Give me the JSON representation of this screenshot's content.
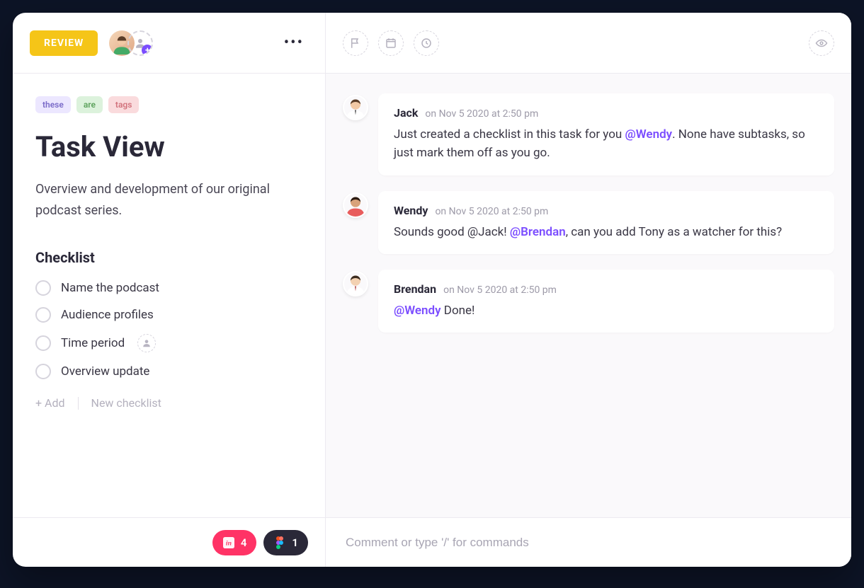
{
  "header": {
    "status_label": "REVIEW"
  },
  "tags": [
    {
      "label": "these",
      "cls": "purple"
    },
    {
      "label": "are",
      "cls": "green"
    },
    {
      "label": "tags",
      "cls": "pink"
    }
  ],
  "title": "Task View",
  "description": "Overview and development of our original podcast series.",
  "checklist": {
    "title": "Checklist",
    "items": [
      {
        "label": "Name the podcast",
        "assignable": false
      },
      {
        "label": "Audience profiles",
        "assignable": false
      },
      {
        "label": "Time period",
        "assignable": true
      },
      {
        "label": "Overview update",
        "assignable": false
      }
    ],
    "add_label": "+ Add",
    "new_label": "New checklist"
  },
  "footer_chips": {
    "invision_count": "4",
    "figma_count": "1"
  },
  "comments": [
    {
      "author": "Jack",
      "time": "on Nov 5 2020 at 2:50 pm",
      "body_parts": [
        {
          "t": "Just created a checklist in this task for you "
        },
        {
          "t": "@Wendy",
          "mention": true
        },
        {
          "t": ". None have subtasks, so just mark them off as you go."
        }
      ]
    },
    {
      "author": "Wendy",
      "time": "on Nov 5 2020 at 2:50 pm",
      "body_parts": [
        {
          "t": "Sounds good @Jack! "
        },
        {
          "t": "@Brendan",
          "mention": true
        },
        {
          "t": ", can you add Tony as a watcher for this?"
        }
      ]
    },
    {
      "author": "Brendan",
      "time": "on Nov 5 2020 at 2:50 pm",
      "body_parts": [
        {
          "t": "@Wendy",
          "mention": true
        },
        {
          "t": " Done!"
        }
      ]
    }
  ],
  "composer": {
    "placeholder": "Comment or type '/' for commands"
  },
  "avatar_colors": {
    "jack": {
      "skin": "#f2c9a5",
      "hair": "#5a3d28",
      "shirt": "#ffffff",
      "tie": "#3a3a3a"
    },
    "wendy": {
      "skin": "#d8a27a",
      "hair": "#2b1b12",
      "shirt": "#e85c5c"
    },
    "brendan": {
      "skin": "#f3d1b1",
      "hair": "#3b2b1f",
      "shirt": "#ffffff",
      "tie": "#a33"
    },
    "assignee": {
      "skin": "#f2c9a5",
      "hair": "#5a3d28",
      "shirt": "#4a6"
    }
  }
}
